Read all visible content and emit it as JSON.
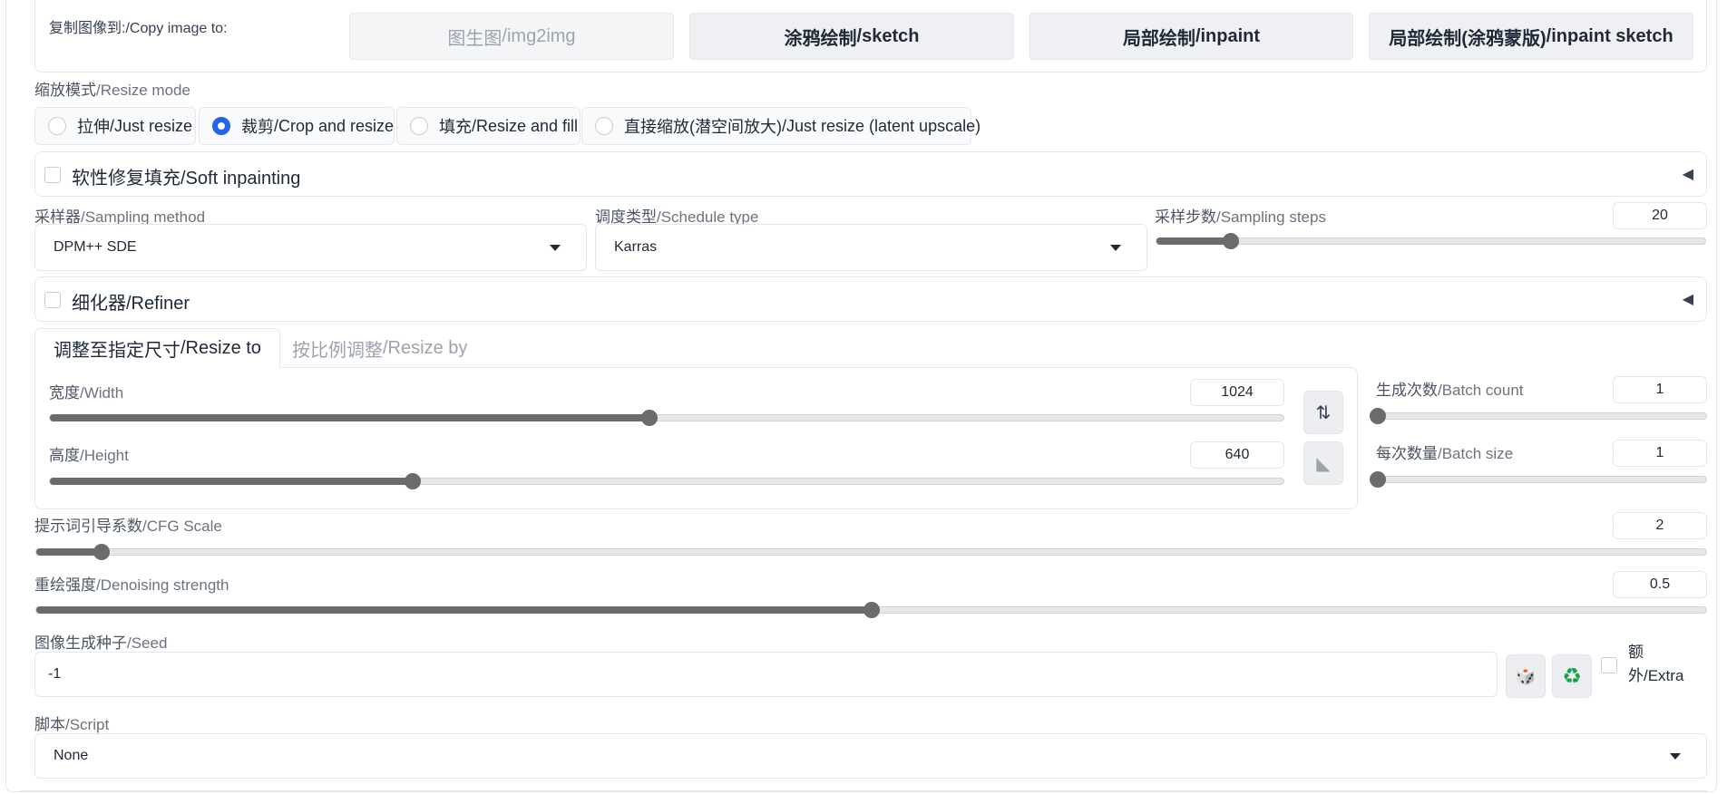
{
  "copy_image": {
    "label_zh": "复制图像到:",
    "label_en": "/Copy image to:",
    "buttons": [
      {
        "zh": "图生图",
        "en": "/img2img"
      },
      {
        "zh": "涂鸦绘制",
        "en": "/sketch"
      },
      {
        "zh": "局部绘制",
        "en": "/inpaint"
      },
      {
        "zh": "局部绘制(涂鸦蒙版)",
        "en": "/inpaint sketch"
      }
    ]
  },
  "resize_mode": {
    "label_zh": "缩放模式",
    "label_en": "/Resize mode",
    "options": [
      {
        "zh": "拉伸",
        "en": "/Just resize",
        "selected": false
      },
      {
        "zh": "裁剪",
        "en": "/Crop and resize",
        "selected": true
      },
      {
        "zh": "填充",
        "en": "/Resize and fill",
        "selected": false
      },
      {
        "zh": "直接缩放(潜空间放大)",
        "en": "/Just resize (latent upscale)",
        "selected": false
      }
    ]
  },
  "soft_inpainting": {
    "zh": "软性修复填充",
    "en": "/Soft inpainting",
    "arrow": "◀"
  },
  "sampler": {
    "label_zh": "采样器",
    "label_en": "/Sampling method",
    "value": "DPM++ SDE"
  },
  "schedule": {
    "label_zh": "调度类型",
    "label_en": "/Schedule type",
    "value": "Karras"
  },
  "steps": {
    "label_zh": "采样步数",
    "label_en": "/Sampling steps",
    "value": "20",
    "fraction": 0.135
  },
  "refiner": {
    "zh": "细化器",
    "en": "/Refiner",
    "arrow": "◀"
  },
  "tabs": [
    {
      "zh": "调整至指定尺寸",
      "en": "/Resize to",
      "active": true
    },
    {
      "zh": "按比例调整",
      "en": "/Resize by",
      "active": false
    }
  ],
  "width": {
    "label_zh": "宽度",
    "label_en": "/Width",
    "value": "1024",
    "fraction": 0.486
  },
  "height": {
    "label_zh": "高度",
    "label_en": "/Height",
    "value": "640",
    "fraction": 0.294
  },
  "batch_count": {
    "label_zh": "生成次数",
    "label_en": "/Batch count",
    "value": "1",
    "fraction": 0
  },
  "batch_size": {
    "label_zh": "每次数量",
    "label_en": "/Batch size",
    "value": "1",
    "fraction": 0
  },
  "cfg": {
    "label_zh": "提示词引导系数",
    "label_en": "/CFG Scale",
    "value": "2",
    "fraction": 0.039
  },
  "denoise": {
    "label_zh": "重绘强度",
    "label_en": "/Denoising strength",
    "value": "0.5",
    "fraction": 0.5
  },
  "seed": {
    "label_zh": "图像生成种子",
    "label_en": "/Seed",
    "value": "-1",
    "dice": "🎲",
    "recycle": "♻",
    "extra_zh": "额",
    "extra_en": "外/Extra"
  },
  "script": {
    "label_zh": "脚本",
    "label_en": "/Script",
    "value": "None"
  },
  "icons": {
    "swap": "⇅",
    "aspect": "◣"
  }
}
